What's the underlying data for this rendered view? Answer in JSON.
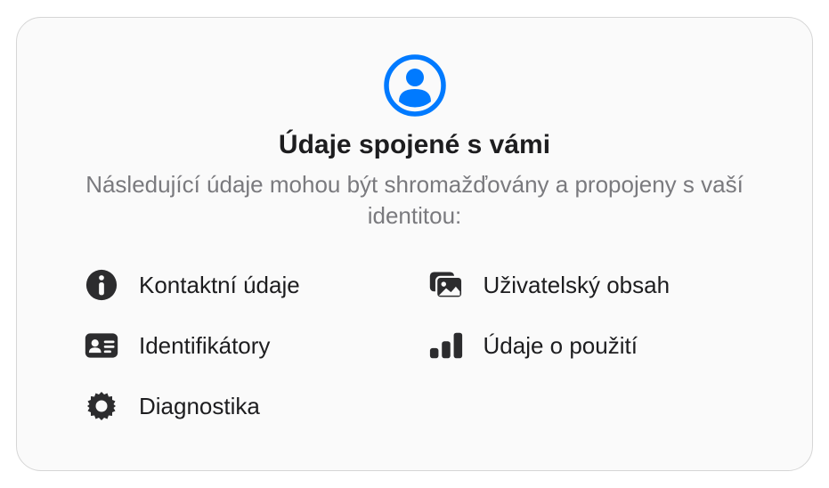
{
  "header": {
    "title": "Údaje spojené s vámi",
    "subtitle": "Následující údaje mohou být shromažďovány a propojeny s vaší identitou:"
  },
  "items": [
    {
      "icon": "info-icon",
      "label": "Kontaktní údaje"
    },
    {
      "icon": "user-content-icon",
      "label": "Uživatelský obsah"
    },
    {
      "icon": "identifiers-icon",
      "label": "Identifikátory"
    },
    {
      "icon": "usage-data-icon",
      "label": "Údaje o použití"
    },
    {
      "icon": "diagnostics-icon",
      "label": "Diagnostika"
    }
  ],
  "colors": {
    "accent": "#007aff",
    "iconFill": "#2c2c2e"
  }
}
